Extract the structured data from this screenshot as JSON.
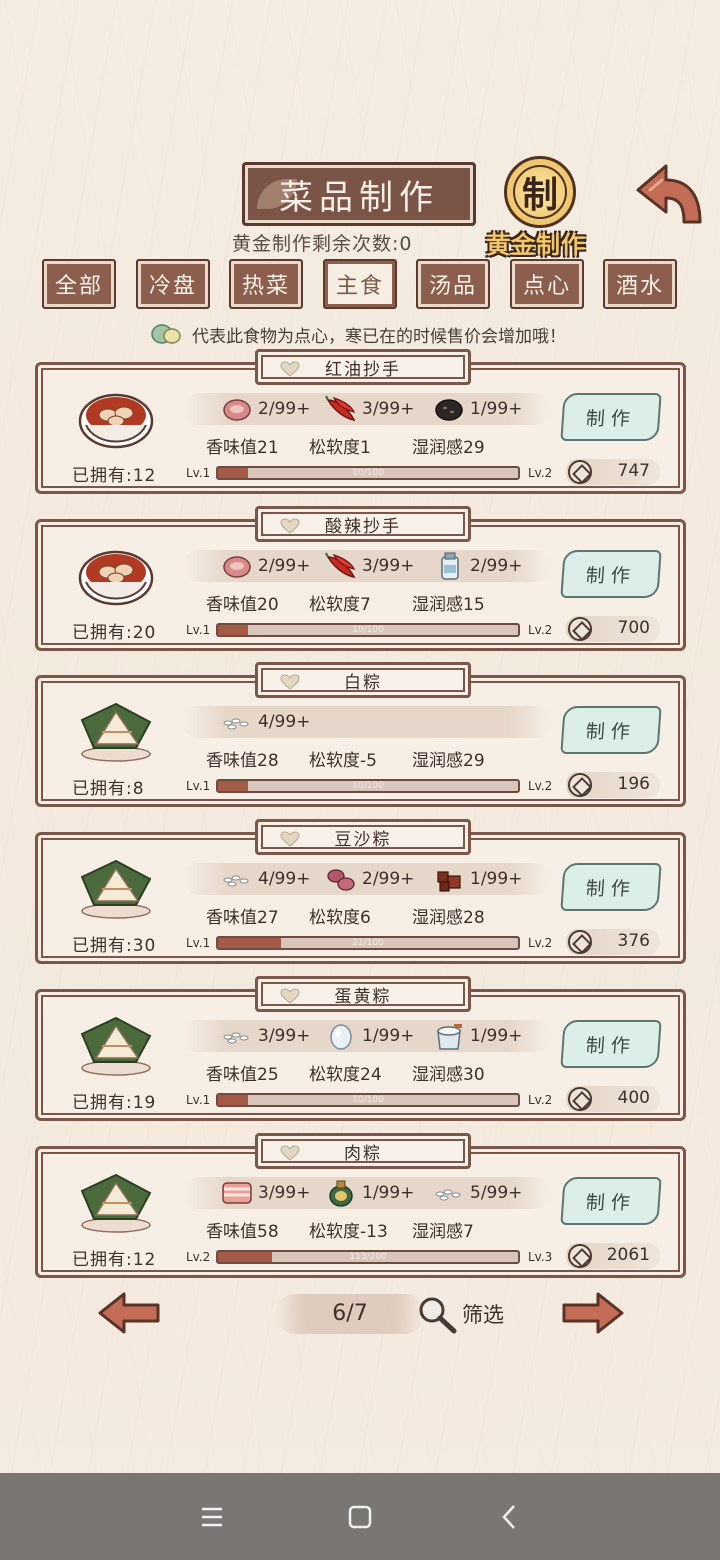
{
  "header": {
    "title": "菜品制作",
    "gold_count_label": "黄金制作剩余次数:0",
    "seal_char": "制",
    "gold_label": "黄金制作"
  },
  "tabs": [
    {
      "label": "全部",
      "active": false
    },
    {
      "label": "冷盘",
      "active": false
    },
    {
      "label": "热菜",
      "active": false
    },
    {
      "label": "主食",
      "active": true
    },
    {
      "label": "汤品",
      "active": false
    },
    {
      "label": "点心",
      "active": false
    },
    {
      "label": "酒水",
      "active": false
    }
  ],
  "hint": "代表此食物为点心，寒已在的时候售价会增加哦！",
  "recipes": [
    {
      "name": "红油抄手",
      "dish": "dumpling-soup-bowl",
      "ingredients": [
        {
          "icon": "pork-icon",
          "qty": "2/99+"
        },
        {
          "icon": "chili-icon",
          "qty": "3/99+"
        },
        {
          "icon": "sesame-icon",
          "qty": "1/99+"
        }
      ],
      "stats": {
        "aroma": "香味值21",
        "softness": "松软度1",
        "moisture": "湿润感29"
      },
      "owned": "已拥有:12",
      "lv": "Lv.1",
      "next_lv": "Lv.2",
      "progress_text": "10/100",
      "progress": 0.1,
      "make": "制作",
      "price": "747"
    },
    {
      "name": "酸辣抄手",
      "dish": "dumpling-soup-bowl",
      "ingredients": [
        {
          "icon": "pork-icon",
          "qty": "2/99+"
        },
        {
          "icon": "chili-icon",
          "qty": "3/99+"
        },
        {
          "icon": "vinegar-icon",
          "qty": "2/99+"
        }
      ],
      "stats": {
        "aroma": "香味值20",
        "softness": "松软度7",
        "moisture": "湿润感15"
      },
      "owned": "已拥有:20",
      "lv": "Lv.1",
      "next_lv": "Lv.2",
      "progress_text": "10/100",
      "progress": 0.1,
      "make": "制作",
      "price": "700"
    },
    {
      "name": "白粽",
      "dish": "zongzi",
      "ingredients": [
        {
          "icon": "rice-icon",
          "qty": "4/99+"
        }
      ],
      "stats": {
        "aroma": "香味值28",
        "softness": "松软度-5",
        "moisture": "湿润感29"
      },
      "owned": "已拥有:8",
      "lv": "Lv.1",
      "next_lv": "Lv.2",
      "progress_text": "10/100",
      "progress": 0.1,
      "make": "制作",
      "price": "196"
    },
    {
      "name": "豆沙粽",
      "dish": "zongzi",
      "ingredients": [
        {
          "icon": "rice-icon",
          "qty": "4/99+"
        },
        {
          "icon": "red-bean-icon",
          "qty": "2/99+"
        },
        {
          "icon": "brown-sugar-icon",
          "qty": "1/99+"
        }
      ],
      "stats": {
        "aroma": "香味值27",
        "softness": "松软度6",
        "moisture": "湿润感28"
      },
      "owned": "已拥有:30",
      "lv": "Lv.1",
      "next_lv": "Lv.2",
      "progress_text": "21/100",
      "progress": 0.21,
      "make": "制作",
      "price": "376"
    },
    {
      "name": "蛋黄粽",
      "dish": "zongzi",
      "ingredients": [
        {
          "icon": "rice-icon",
          "qty": "3/99+"
        },
        {
          "icon": "egg-icon",
          "qty": "1/99+"
        },
        {
          "icon": "salt-icon",
          "qty": "1/99+"
        }
      ],
      "stats": {
        "aroma": "香味值25",
        "softness": "松软度24",
        "moisture": "湿润感30"
      },
      "owned": "已拥有:19",
      "lv": "Lv.1",
      "next_lv": "Lv.2",
      "progress_text": "10/100",
      "progress": 0.1,
      "make": "制作",
      "price": "400"
    },
    {
      "name": "肉粽",
      "dish": "zongzi",
      "ingredients": [
        {
          "icon": "pork-belly-icon",
          "qty": "3/99+"
        },
        {
          "icon": "soy-sauce-icon",
          "qty": "1/99+"
        },
        {
          "icon": "rice-icon",
          "qty": "5/99+"
        }
      ],
      "stats": {
        "aroma": "香味值58",
        "softness": "松软度-13",
        "moisture": "湿润感7"
      },
      "owned": "已拥有:12",
      "lv": "Lv.2",
      "next_lv": "Lv.3",
      "progress_text": "113/200",
      "progress": 0.18,
      "make": "制作",
      "price": "2061"
    }
  ],
  "pagination": {
    "page": "6/7",
    "filter": "筛选"
  },
  "colors": {
    "frame": "#7b5649",
    "tab": "#8b5e4d",
    "button": "#dbeee8",
    "bar_fill": "#a35a46"
  }
}
